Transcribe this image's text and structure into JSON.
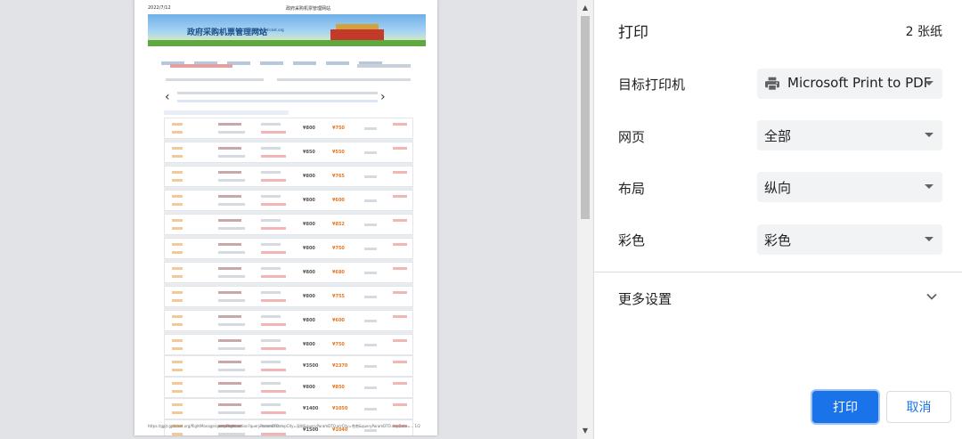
{
  "preview": {
    "header_date": "2022/7/12",
    "header_title": "政府采购机票管理网站",
    "site_name": "政府采购机票管理网站",
    "site_url": "www.gpticket.org",
    "price_rows": [
      {
        "p1": "¥800",
        "p2": "¥750"
      },
      {
        "p1": "¥850",
        "p2": "¥550"
      },
      {
        "p1": "¥800",
        "p2": "¥765"
      },
      {
        "p1": "¥800",
        "p2": "¥600"
      },
      {
        "p1": "¥800",
        "p2": "¥852"
      },
      {
        "p1": "¥800",
        "p2": "¥750"
      },
      {
        "p1": "¥800",
        "p2": "¥680"
      },
      {
        "p1": "¥800",
        "p2": "¥755"
      },
      {
        "p1": "¥800",
        "p2": "¥600"
      },
      {
        "p1": "¥800",
        "p2": "¥750"
      },
      {
        "p1": "¥3500",
        "p2": "¥2370"
      },
      {
        "p1": "¥800",
        "p2": "¥850"
      },
      {
        "p1": "¥1400",
        "p2": "¥1050"
      },
      {
        "p1": "¥1500",
        "p2": "¥1040"
      }
    ],
    "footer_url": "https://gpjt.gpticket.org/flightManage/queryFlight.action?queryParam0TO.depCity=深圳&queryParamDTO.arrCity=苍南&queryParamDTO.depDate=...   1/2"
  },
  "scrollbar": {
    "up_glyph": "▲",
    "down_glyph": "▼"
  },
  "panel": {
    "title": "打印",
    "sheet_count": "2 张纸",
    "printer": {
      "label": "目标打印机",
      "value": "Microsoft Print to PDF",
      "icon": "printer-icon"
    },
    "pages": {
      "label": "网页",
      "value": "全部"
    },
    "layout": {
      "label": "布局",
      "value": "纵向"
    },
    "color": {
      "label": "彩色",
      "value": "彩色"
    },
    "more_settings": {
      "label": "更多设置",
      "icon": "chevron-down-icon"
    },
    "print_button": "打印",
    "cancel_button": "取消"
  },
  "colors": {
    "accent": "#1a73e8",
    "select_bg": "#f1f3f4",
    "preview_bg": "#e1e3e6"
  }
}
